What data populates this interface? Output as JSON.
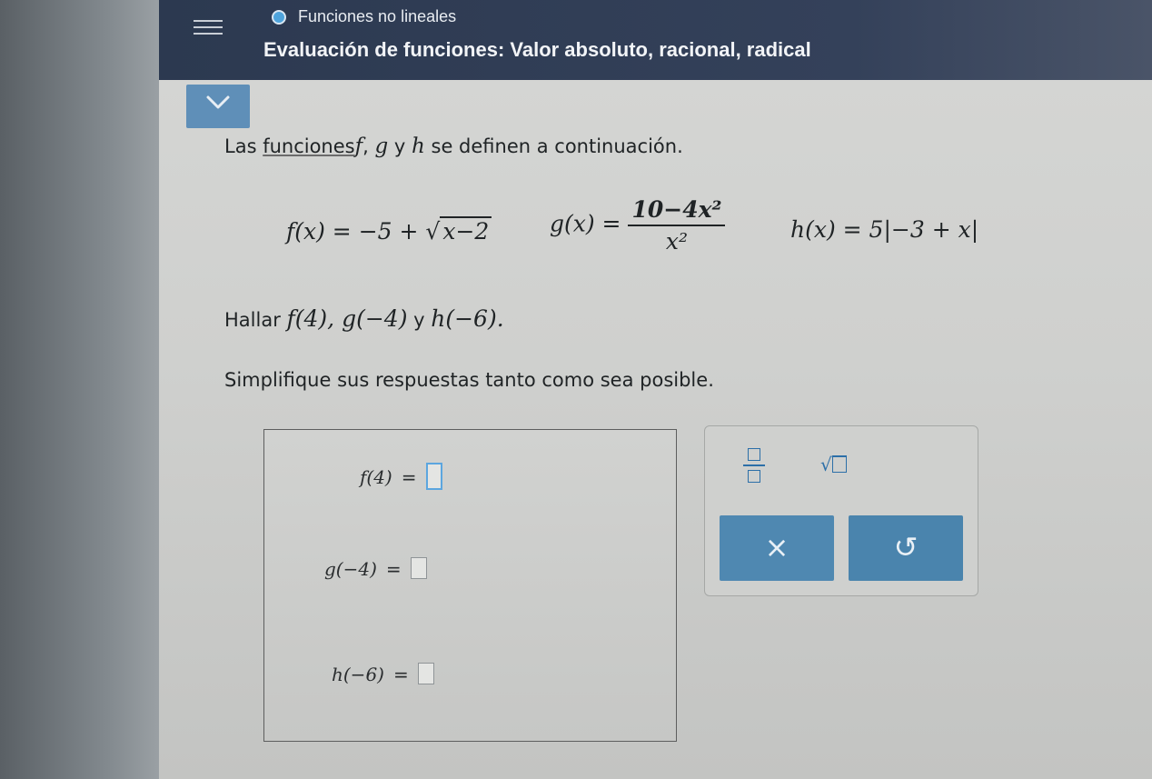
{
  "header": {
    "topic": "Funciones no lineales",
    "lesson": "Evaluación de funciones: Valor absoluto, racional, radical"
  },
  "question": {
    "intro_prefix": "Las ",
    "intro_link": "funciones",
    "intro_f": "f",
    "intro_comma": ", ",
    "intro_g": "g",
    "intro_y": " y ",
    "intro_h": "h",
    "intro_suffix": " se definen a continuación.",
    "f_lhs": "f(x) = −5 + ",
    "f_radicand": "x−2",
    "g_lhs": "g(x) = ",
    "g_num": "10−4x²",
    "g_den": "x²",
    "h_lhs": "h(x) = 5",
    "h_abs": "−3 + x",
    "task_prefix": "Hallar ",
    "task_f": "f(4), ",
    "task_g": "g(−4)",
    "task_y": " y ",
    "task_h": "h(−6).",
    "simplify": "Simplifique sus respuestas tanto como sea posible."
  },
  "answers": {
    "f_label": "f(4)",
    "g_label": "g(−4)",
    "h_label": "h(−6)",
    "equals": "="
  },
  "toolbar": {
    "sqrt_symbol": "√",
    "clear_label": "×",
    "undo_label": "↺"
  },
  "colors": {
    "header_bg": "#2c3950",
    "accent": "#4f88b1",
    "active_input_border": "#5ca6df"
  }
}
